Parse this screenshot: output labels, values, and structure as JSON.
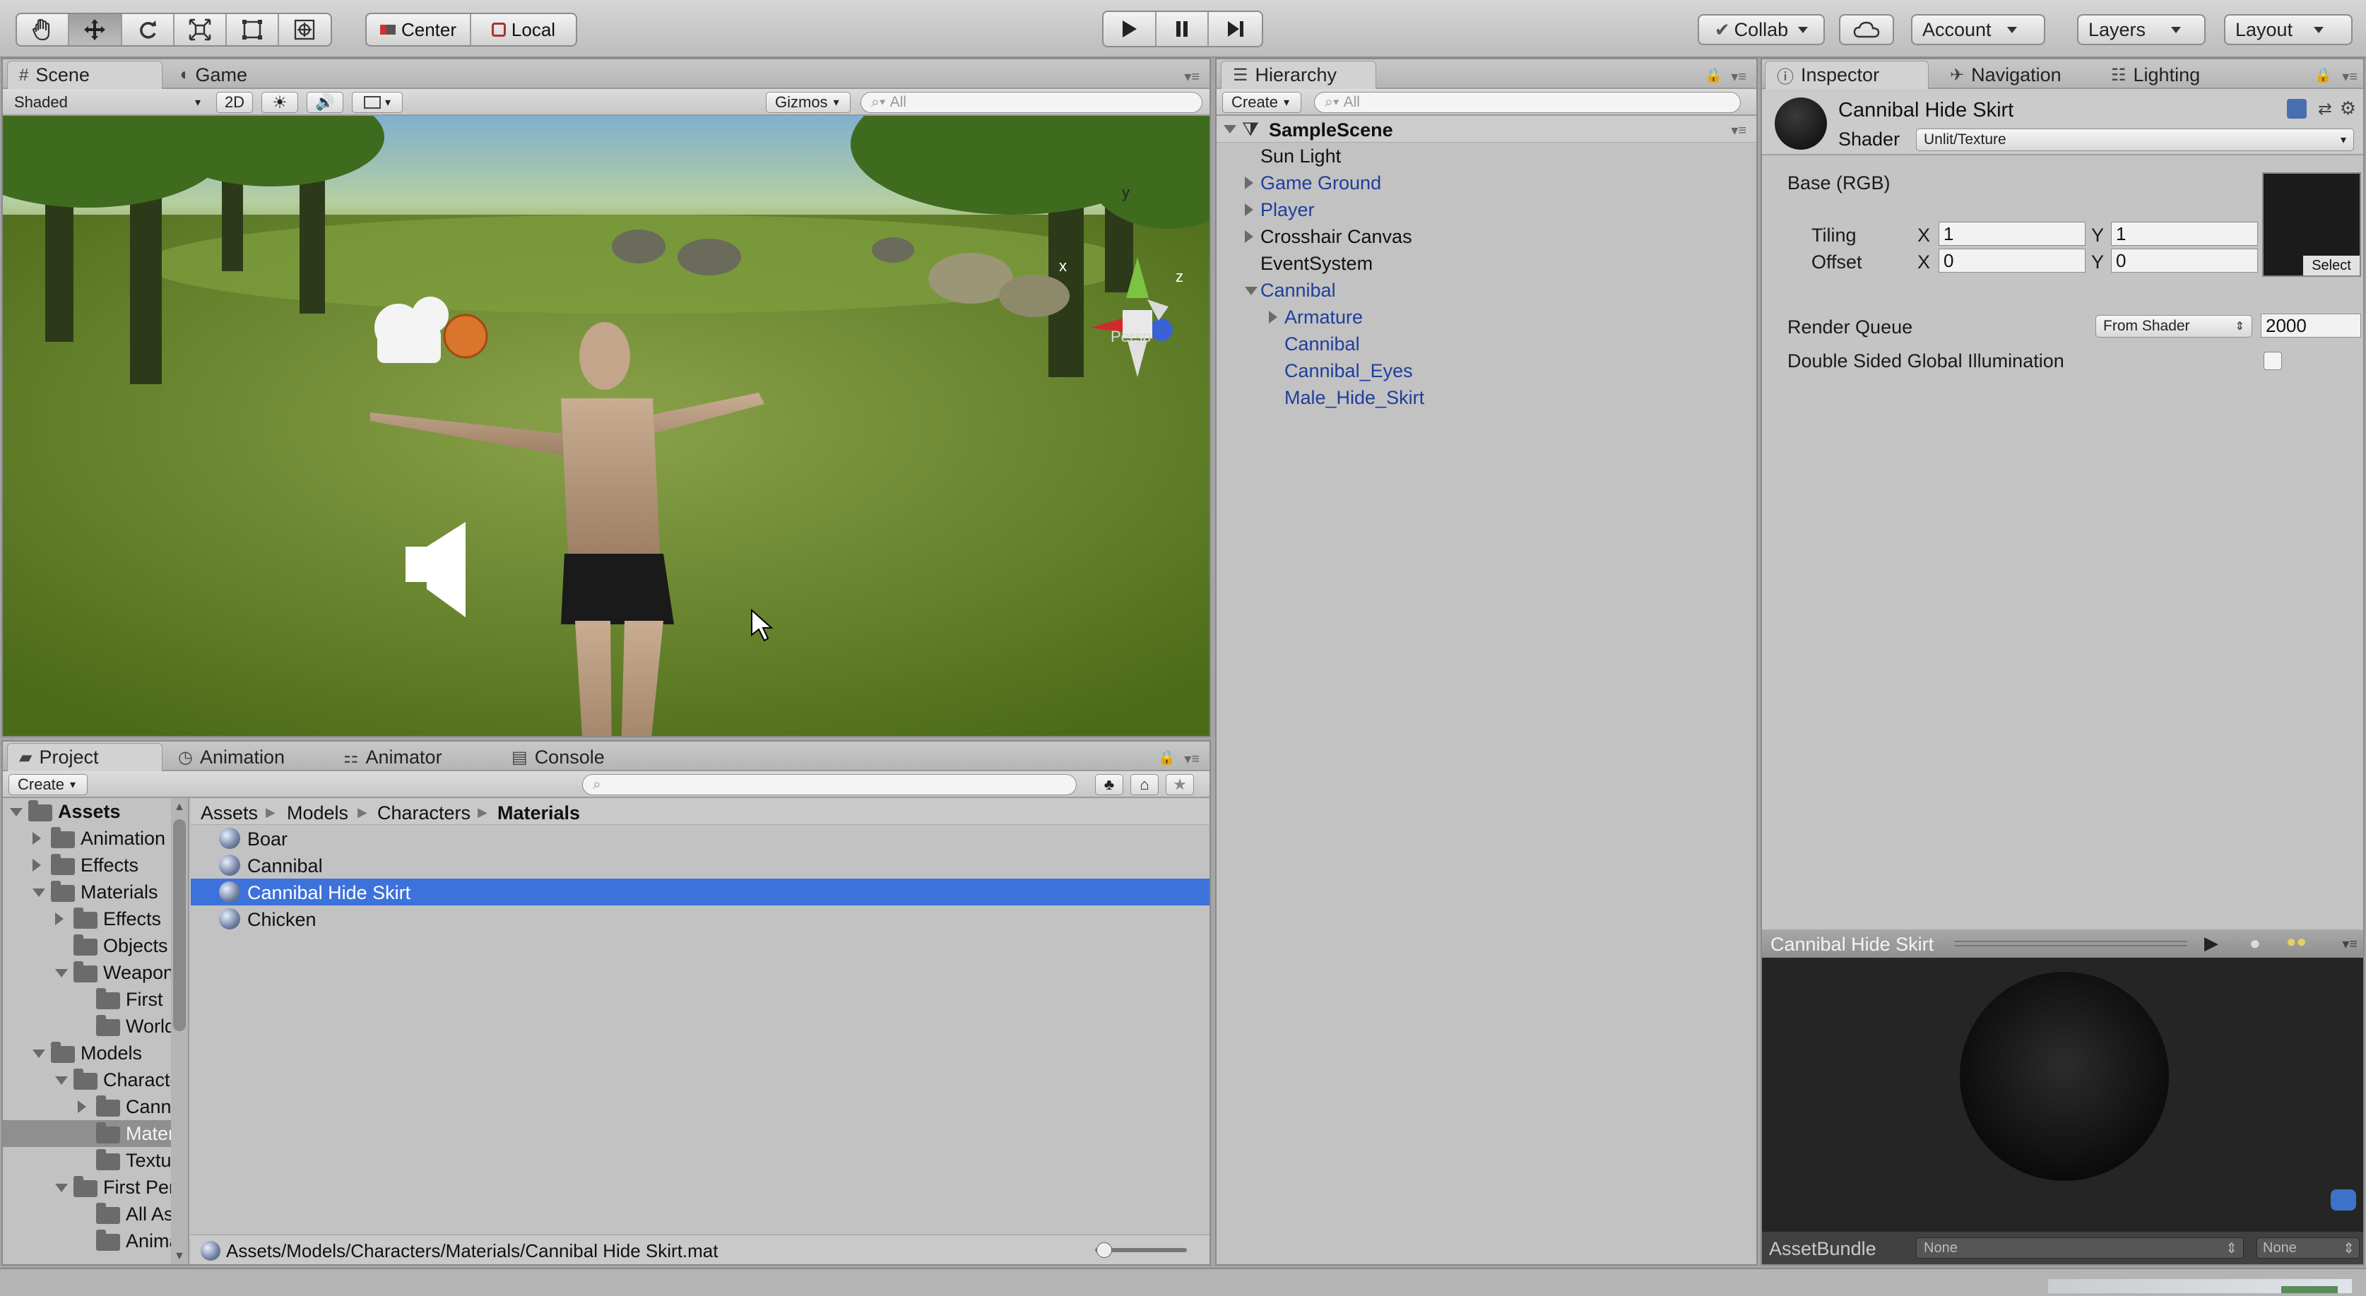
{
  "toolbar": {
    "pivot_center": "Center",
    "pivot_local": "Local",
    "collab": "Collab",
    "account": "Account",
    "layers": "Layers",
    "layout": "Layout",
    "tools": [
      "hand-tool-icon",
      "move-tool-icon",
      "rotate-tool-icon",
      "scale-tool-icon",
      "rect-tool-icon",
      "transform-tool-icon"
    ],
    "play": [
      "play-icon",
      "pause-icon",
      "step-icon"
    ]
  },
  "scene": {
    "tab_scene": "Scene",
    "tab_game": "Game",
    "shading": "Shaded",
    "mode_2d": "2D",
    "gizmos": "Gizmos",
    "search_placeholder": "All",
    "persp": "Persp",
    "axis_x": "x",
    "axis_y": "y",
    "axis_z": "z"
  },
  "hierarchy": {
    "tab": "Hierarchy",
    "create": "Create",
    "search_placeholder": "All",
    "scene_name": "SampleScene",
    "items": [
      {
        "label": "Sun Light",
        "depth": 1,
        "expander": "none",
        "prefab": false
      },
      {
        "label": "Game Ground",
        "depth": 1,
        "expander": "collapsed",
        "prefab": true
      },
      {
        "label": "Player",
        "depth": 1,
        "expander": "collapsed",
        "prefab": true
      },
      {
        "label": "Crosshair Canvas",
        "depth": 1,
        "expander": "collapsed",
        "prefab": false
      },
      {
        "label": "EventSystem",
        "depth": 1,
        "expander": "none",
        "prefab": false
      },
      {
        "label": "Cannibal",
        "depth": 1,
        "expander": "expanded",
        "prefab": true
      },
      {
        "label": "Armature",
        "depth": 2,
        "expander": "collapsed",
        "prefab": true
      },
      {
        "label": "Cannibal",
        "depth": 2,
        "expander": "none",
        "prefab": true
      },
      {
        "label": "Cannibal_Eyes",
        "depth": 2,
        "expander": "none",
        "prefab": true
      },
      {
        "label": "Male_Hide_Skirt",
        "depth": 2,
        "expander": "none",
        "prefab": true
      }
    ]
  },
  "inspector": {
    "tabs": [
      "Inspector",
      "Navigation",
      "Lighting"
    ],
    "material_name": "Cannibal Hide Skirt",
    "shader_label": "Shader",
    "shader_value": "Unlit/Texture",
    "base_label": "Base (RGB)",
    "tiling_label": "Tiling",
    "offset_label": "Offset",
    "x_label": "X",
    "y_label": "Y",
    "tiling_x": "1",
    "tiling_y": "1",
    "offset_x": "0",
    "offset_y": "0",
    "select_label": "Select",
    "render_queue_label": "Render Queue",
    "render_queue_mode": "From Shader",
    "render_queue_value": "2000",
    "double_sided_label": "Double Sided Global Illumination",
    "double_sided_checked": false,
    "preview_title": "Cannibal Hide Skirt",
    "assetbundle_label": "AssetBundle",
    "assetbundle_name": "None",
    "assetbundle_variant": "None"
  },
  "project": {
    "tabs": [
      "Project",
      "Animation",
      "Animator",
      "Console"
    ],
    "create": "Create",
    "breadcrumb": [
      "Assets",
      "Models",
      "Characters",
      "Materials"
    ],
    "tree": [
      {
        "label": "Assets",
        "depth": 0,
        "expander": "expanded",
        "bold": true
      },
      {
        "label": "Animation",
        "depth": 1,
        "expander": "collapsed"
      },
      {
        "label": "Effects",
        "depth": 1,
        "expander": "collapsed"
      },
      {
        "label": "Materials",
        "depth": 1,
        "expander": "expanded"
      },
      {
        "label": "Effects",
        "depth": 2,
        "expander": "collapsed"
      },
      {
        "label": "Objects",
        "depth": 2,
        "expander": "none"
      },
      {
        "label": "Weapons",
        "depth": 2,
        "expander": "expanded"
      },
      {
        "label": "First",
        "depth": 3,
        "expander": "none"
      },
      {
        "label": "World",
        "depth": 3,
        "expander": "none"
      },
      {
        "label": "Models",
        "depth": 1,
        "expander": "expanded"
      },
      {
        "label": "Characters",
        "depth": 2,
        "expander": "expanded"
      },
      {
        "label": "Cannibal",
        "depth": 3,
        "expander": "collapsed"
      },
      {
        "label": "Materials",
        "depth": 3,
        "expander": "none",
        "selected": true
      },
      {
        "label": "Textures",
        "depth": 3,
        "expander": "none"
      },
      {
        "label": "First Person",
        "depth": 2,
        "expander": "expanded"
      },
      {
        "label": "All Assets",
        "depth": 3,
        "expander": "none"
      },
      {
        "label": "Animations",
        "depth": 3,
        "expander": "none"
      }
    ],
    "files": [
      {
        "label": "Boar",
        "selected": false
      },
      {
        "label": "Cannibal",
        "selected": false
      },
      {
        "label": "Cannibal Hide Skirt",
        "selected": true
      },
      {
        "label": "Chicken",
        "selected": false
      }
    ],
    "footer_path": "Assets/Models/Characters/Materials/Cannibal Hide Skirt.mat",
    "zoom_level": 0.02
  }
}
